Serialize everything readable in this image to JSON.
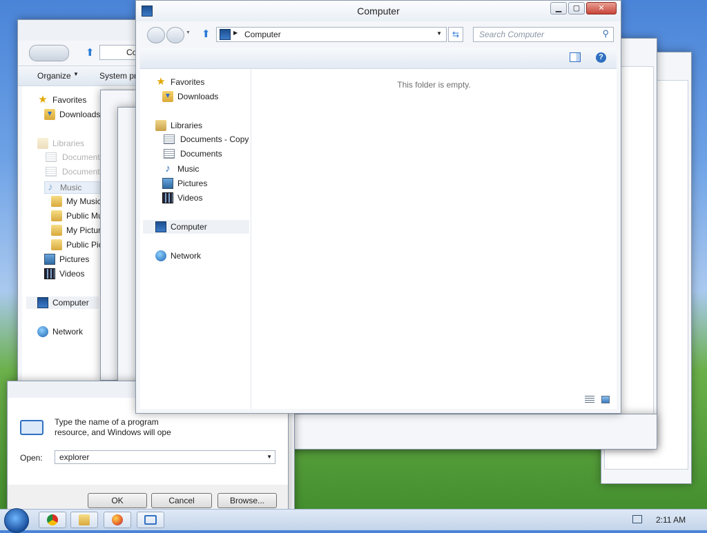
{
  "main_window": {
    "title": "Computer",
    "address": "Computer",
    "search_placeholder": "Search Computer",
    "empty_message": "This folder is empty.",
    "nav": [
      {
        "label": "Favorites",
        "icon": "star-icon"
      },
      {
        "label": "Downloads",
        "icon": "downloads-folder-icon"
      },
      {
        "label": "Libraries",
        "icon": "libraries-icon"
      },
      {
        "label": "Documents - Copy",
        "icon": "document-icon"
      },
      {
        "label": "Documents",
        "icon": "document-icon"
      },
      {
        "label": "Music",
        "icon": "music-icon"
      },
      {
        "label": "Pictures",
        "icon": "pictures-icon"
      },
      {
        "label": "Videos",
        "icon": "videos-icon"
      },
      {
        "label": "Computer",
        "icon": "computer-icon"
      },
      {
        "label": "Network",
        "icon": "network-icon"
      }
    ]
  },
  "back_window": {
    "address": "Co",
    "toolbar": {
      "organize": "Organize",
      "system": "System pr"
    },
    "nav": [
      {
        "label": "Favorites"
      },
      {
        "label": "Downloads"
      },
      {
        "label": "Libraries"
      },
      {
        "label": "Documents"
      },
      {
        "label": "Documents"
      },
      {
        "label": "Music"
      },
      {
        "label": "My Music"
      },
      {
        "label": "Public Mu"
      },
      {
        "label": "My Pictur"
      },
      {
        "label": "Public Pic"
      },
      {
        "label": "Pictures"
      },
      {
        "label": "Videos"
      },
      {
        "label": "Computer"
      },
      {
        "label": "Network"
      }
    ]
  },
  "run_dialog": {
    "description_line1": "Type the name of a program",
    "description_line2": "resource, and Windows will ope",
    "open_label": "Open:",
    "open_value": "explorer",
    "ok": "OK",
    "cancel": "Cancel",
    "browse": "Browse..."
  },
  "taskbar": {
    "clock": "2:11 AM",
    "apps": [
      "chrome-icon",
      "folder-icon",
      "firefox-icon",
      "run-icon"
    ]
  }
}
